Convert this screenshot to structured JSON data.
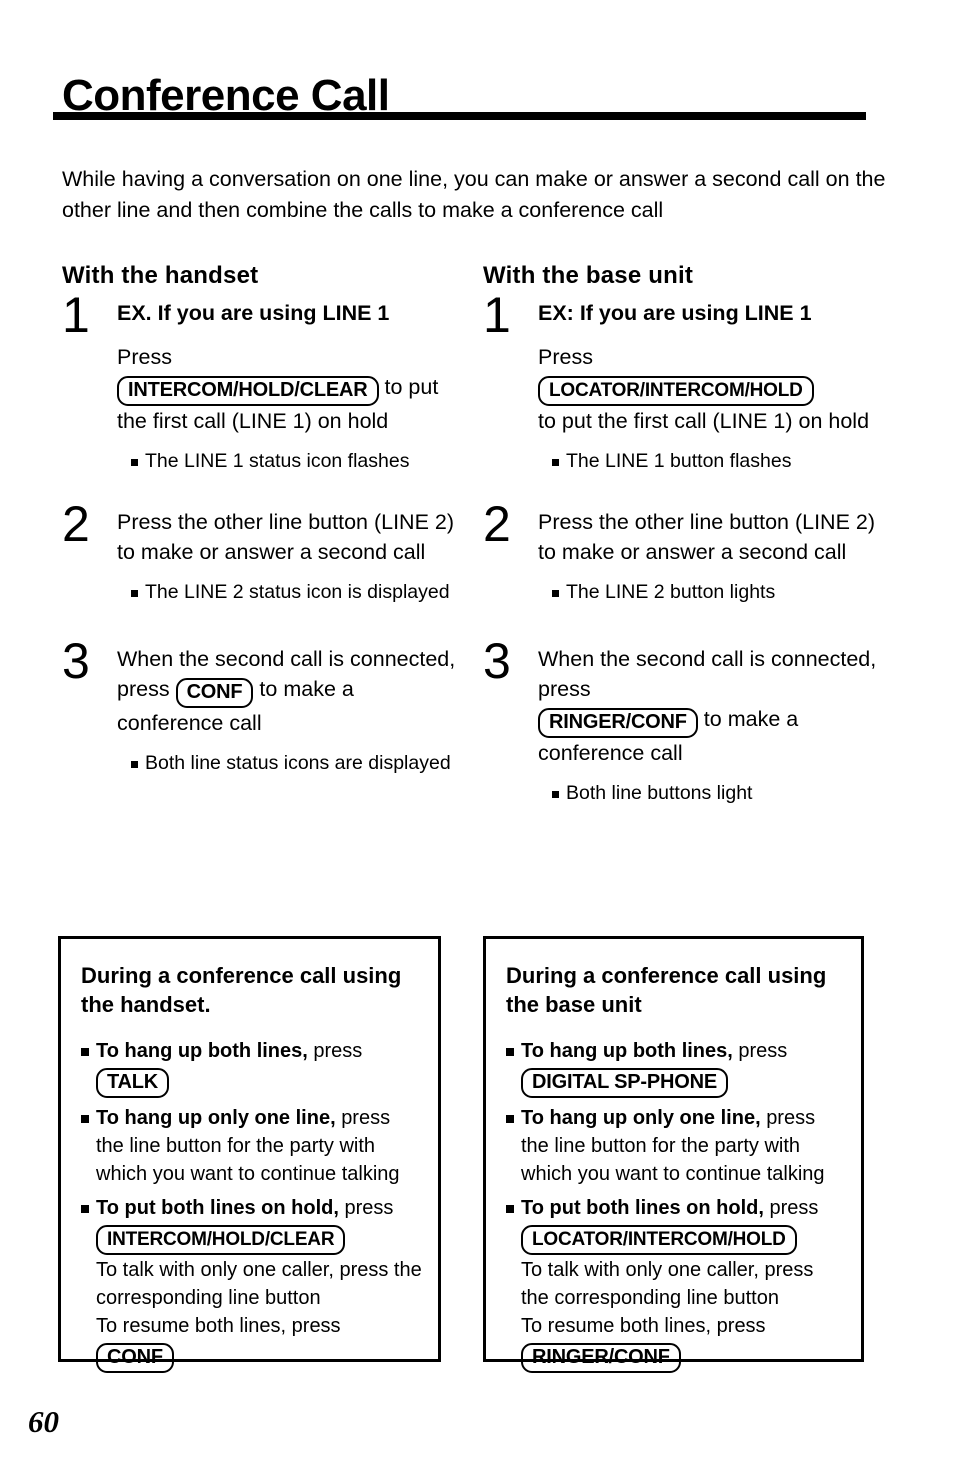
{
  "document": {
    "title": "Conference Call",
    "intro": "While having a conversation on one line, you can make or answer a second call on the other line and then combine the calls to make a conference call",
    "page_number": "60"
  },
  "columns": {
    "left": {
      "heading": "With the handset",
      "steps": [
        {
          "number": "1",
          "lead": "EX. If you are using LINE 1",
          "text_before_key": "Press",
          "key": "INTERCOM/HOLD/CLEAR",
          "text_after_key": "to put the first call (LINE 1) on hold",
          "notes": [
            "The LINE 1 status icon flashes"
          ]
        },
        {
          "number": "2",
          "text": "Press the other line button (LINE 2) to make or answer a second call",
          "notes": [
            "The LINE 2 status icon is displayed"
          ]
        },
        {
          "number": "3",
          "text_before_key": "When the second call is connected, press",
          "key": "CONF",
          "text_after_key": "to make a conference call",
          "notes": [
            "Both line status icons are displayed"
          ]
        }
      ]
    },
    "right": {
      "heading": "With the base unit",
      "steps": [
        {
          "number": "1",
          "lead": "EX: If you are using LINE 1",
          "text_before_key": "Press",
          "key": "LOCATOR/INTERCOM/HOLD",
          "text_after_key": "to put the first call (LINE 1) on hold",
          "notes": [
            "The LINE 1 button flashes"
          ]
        },
        {
          "number": "2",
          "text": "Press the other line button (LINE 2) to make or answer a second call",
          "notes": [
            "The LINE 2 button lights"
          ]
        },
        {
          "number": "3",
          "text_before_key": "When the second call is connected, press",
          "key": "RINGER/CONF",
          "text_after_key": "to make a conference call",
          "notes": [
            "Both line buttons light"
          ]
        }
      ]
    }
  },
  "boxes": {
    "left": {
      "title": "During a conference call using the handset.",
      "items": [
        {
          "bold": "To hang up both lines,",
          "plain": "press",
          "key": "TALK"
        },
        {
          "bold": "To hang up only one line,",
          "plain": "press",
          "continuation": "the line button for the party with which you want to continue talking"
        },
        {
          "bold": "To put both lines on hold,",
          "plain": "press",
          "key": "INTERCOM/HOLD/CLEAR",
          "tail_1": "To talk with only one caller, press the corresponding line button",
          "tail_2": "To resume both lines, press",
          "key_2": "CONF"
        }
      ]
    },
    "right": {
      "title": "During a conference call using the base unit",
      "items": [
        {
          "bold": "To hang up both lines,",
          "plain": "press",
          "key": "DIGITAL SP-PHONE"
        },
        {
          "bold": "To hang up only one line,",
          "plain": "press",
          "continuation": "the line button for the party with which you want to continue talking"
        },
        {
          "bold": "To put both lines on hold,",
          "plain": "press",
          "key": "LOCATOR/INTERCOM/HOLD",
          "tail_1": "To talk with only one caller, press the corresponding line button",
          "tail_2": "To resume both lines, press",
          "key_2": "RINGER/CONF"
        }
      ]
    }
  }
}
